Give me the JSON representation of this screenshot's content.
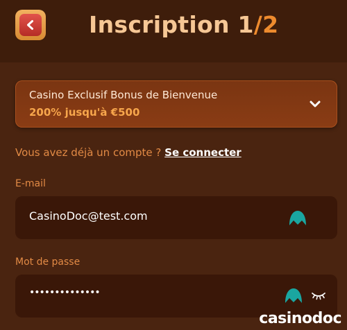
{
  "header": {
    "title_main": "Inscription 1",
    "title_sep": "/",
    "title_total": "2"
  },
  "bonus": {
    "line1": "Casino Exclusif Bonus de Bienvenue",
    "line2": "200% jusqu'à €500"
  },
  "login": {
    "prompt": "Vous avez déjà un compte ?",
    "link": "Se connecter"
  },
  "email": {
    "label": "E-mail",
    "value": "CasinoDoc@test.com"
  },
  "password": {
    "label": "Mot de passe",
    "value": "••••••••••••••"
  },
  "watermark": "casinodoc",
  "colors": {
    "background": "#4a2410",
    "accent": "#ee8b2e",
    "input_bg": "#3a1708",
    "extension_icon": "#1aa6a0"
  },
  "icons": {
    "back": "chevron-left-icon",
    "dropdown": "chevron-down-icon",
    "extension": "password-manager-icon",
    "toggle_visibility": "eye-closed-icon"
  }
}
